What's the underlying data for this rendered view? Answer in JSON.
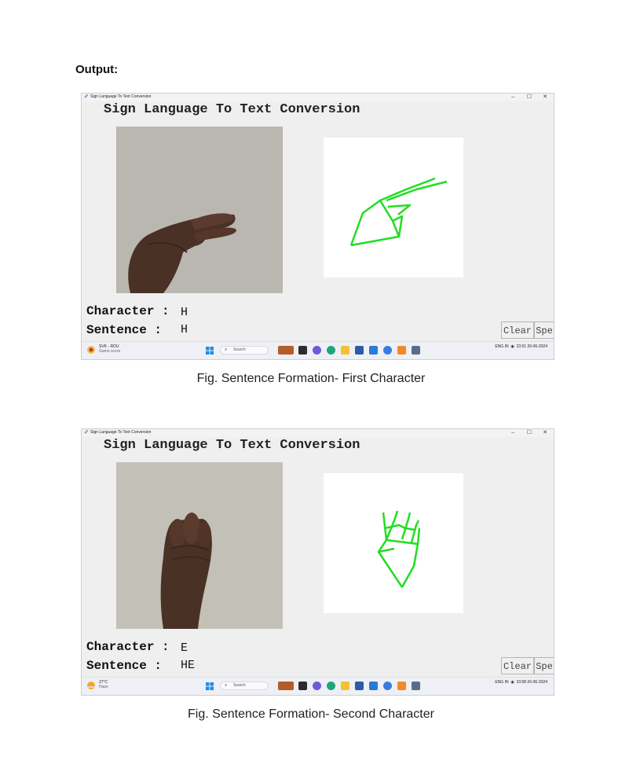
{
  "heading": "Output:",
  "window": {
    "title": "Sign Language To Text Conversion",
    "app_title": "Sign Language To Text Conversion",
    "controls": [
      "–",
      "☐",
      "✕"
    ],
    "character_label": "Character :",
    "sentence_label": "Sentence :",
    "clear_label": "Clear",
    "speak_label": "Spe"
  },
  "taskbar_common": {
    "search_placeholder": "Search",
    "lang": "ENG",
    "region": "IN",
    "date": "26-06-2024"
  },
  "screenshots": [
    {
      "character": "H",
      "sentence": "H",
      "weather_line1": "SVK - ROU",
      "weather_line2": "Game score",
      "time": "23:51",
      "caption": "Fig. Sentence Formation- First Character",
      "gesture": "two-fingers-horizontal-icon"
    },
    {
      "character": "E",
      "sentence": "HE",
      "weather_line1": "27°C",
      "weather_line2": "Haze",
      "time": "23:58",
      "caption": "Fig. Sentence Formation- Second Character",
      "gesture": "closed-fingers-icon"
    }
  ],
  "colors": {
    "skeleton": "#22dd22",
    "window_bg": "#efefef",
    "wall": "#bdbab3",
    "skin": "#4a3126"
  }
}
